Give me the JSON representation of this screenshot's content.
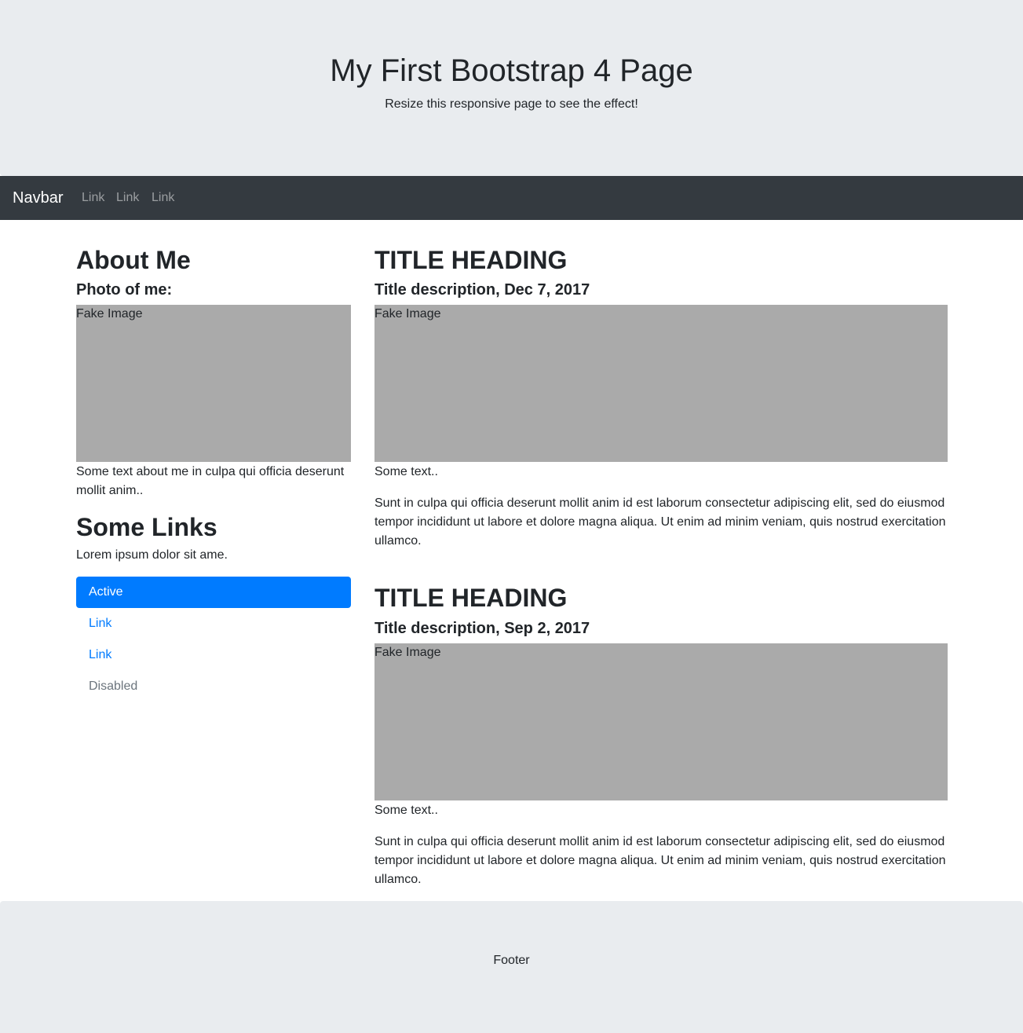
{
  "header": {
    "title": "My First Bootstrap 4 Page",
    "subtitle": "Resize this responsive page to see the effect!"
  },
  "navbar": {
    "brand": "Navbar",
    "links": [
      "Link",
      "Link",
      "Link"
    ]
  },
  "sidebar": {
    "about_heading": "About Me",
    "photo_heading": "Photo of me:",
    "image_label": "Fake Image",
    "about_text": "Some text about me in culpa qui officia deserunt mollit anim..",
    "links_heading": "Some Links",
    "links_text": "Lorem ipsum dolor sit ame.",
    "nav_pills": [
      {
        "label": "Active",
        "state": "active"
      },
      {
        "label": "Link",
        "state": "link"
      },
      {
        "label": "Link",
        "state": "link"
      },
      {
        "label": "Disabled",
        "state": "disabled"
      }
    ]
  },
  "posts": [
    {
      "heading": "TITLE HEADING",
      "description": "Title description, Dec 7, 2017",
      "image_label": "Fake Image",
      "short_text": "Some text..",
      "body": "Sunt in culpa qui officia deserunt mollit anim id est laborum consectetur adipiscing elit, sed do eiusmod tempor incididunt ut labore et dolore magna aliqua. Ut enim ad minim veniam, quis nostrud exercitation ullamco."
    },
    {
      "heading": "TITLE HEADING",
      "description": "Title description, Sep 2, 2017",
      "image_label": "Fake Image",
      "short_text": "Some text..",
      "body": "Sunt in culpa qui officia deserunt mollit anim id est laborum consectetur adipiscing elit, sed do eiusmod tempor incididunt ut labore et dolore magna aliqua. Ut enim ad minim veniam, quis nostrud exercitation ullamco."
    }
  ],
  "footer": {
    "text": "Footer"
  },
  "colors": {
    "jumbotron_bg": "#e9ecef",
    "navbar_bg": "#343a40",
    "primary": "#007bff",
    "fake_image": "#aaaaaa",
    "muted": "#6c757d"
  }
}
